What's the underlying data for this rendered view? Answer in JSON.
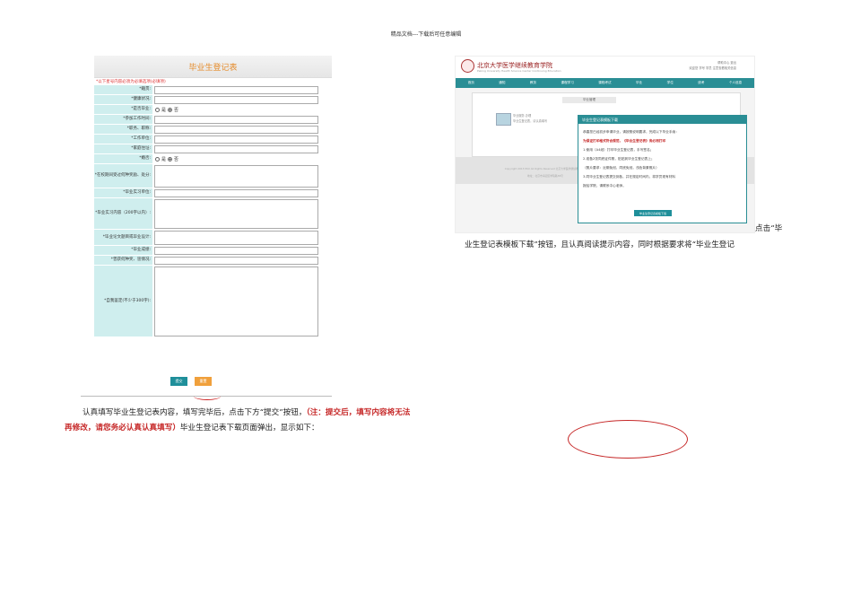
{
  "header": {
    "text": "精品文档---下载后可任意编辑"
  },
  "form": {
    "title": "毕业生登记表",
    "note": "*以下星号内容必须为必填选项(必填项)",
    "fields": [
      {
        "label": "*籍贯:"
      },
      {
        "label": "*健康状况:"
      },
      {
        "label": "*是否毕业:",
        "radio": [
          "是",
          "否"
        ]
      },
      {
        "label": "*参加工作时间:"
      },
      {
        "label": "*职务、职称:"
      },
      {
        "label": "*工作单位:"
      },
      {
        "label": "*家庭住址:"
      },
      {
        "label": "*婚否:",
        "radio": [
          "是",
          "否"
        ]
      },
      {
        "label": "*在校期间受过何种奖励、处分:"
      },
      {
        "label": "*毕业实习单位:"
      },
      {
        "label": "*毕业实习内容（200字以内）:"
      },
      {
        "label": "*毕业论文题目或毕业设计:"
      },
      {
        "label": "*毕业成绩:"
      },
      {
        "label": "*曾获何种奖、惩情况:"
      },
      {
        "label": "*自我鉴定(不少于300字):"
      }
    ],
    "submit_label": "提交",
    "reset_label": "重置"
  },
  "left_paragraph": {
    "part1": "认真填写毕业生登记表内容，填写完毕后，点击下方“提交”按钮，",
    "red": "（注：提交后，填写内容将无法再修改，请您务必认真认真填写）",
    "part2": "毕业生登记表下载页面弹出，显示如下："
  },
  "site": {
    "logo": "北京大学医学继续教育学院",
    "logo_sub": "Peking University Health Science Center Continuing Education",
    "top_links": [
      "帮助中心  退出",
      "欢迎您 学号 学员   注意查看相关信息"
    ],
    "nav": [
      "首页",
      "通知",
      "教务",
      "课程学习",
      "课程考试",
      "毕业",
      "学位",
      "统考",
      "个人信息"
    ],
    "tab": "毕业管理",
    "card_title": "毕业服务 办理",
    "card_sub": "毕业生登记表，请认真填写",
    "footer_line1": "Copyright 2013 PKU All Rights Reserved 北京大学医学继续教育学院",
    "footer_line2": "地址：北京市海淀区学院路38号"
  },
  "modal": {
    "title": "毕业生登记表模板下载",
    "lines": [
      "恭喜您已经初步申请毕业，请按照说明要求，完成以下毕业手续：",
      "为保证打印格式符合规范，《毕业生登记表》务必用打印",
      "1.使用（A4纸）打印毕业生登记表，手写签名；",
      "2.准备2张同底证件照，贴贴到毕业生登记表上；",
      "（照片要求：近期免冠，同底免冠，浅色背景照片）",
      "3.同毕业生登记表提交到各，并在规定时间内，将学员现有材料",
      "报给学院，请联系中心老师。"
    ],
    "button": "毕业生登记表模板下载"
  },
  "right_tail": "点击“毕",
  "right_paragraph": "业生登记表模板下载”按钮，且认真阅读提示内容，同时根据要求将“毕业生登记"
}
